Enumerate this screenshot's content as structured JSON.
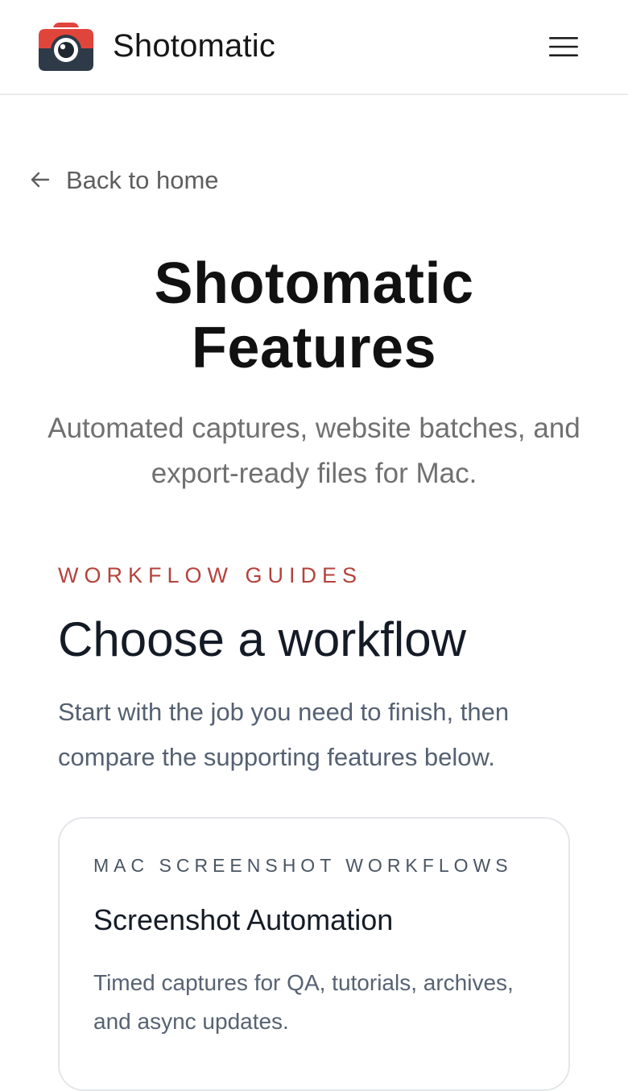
{
  "header": {
    "brand_name": "Shotomatic",
    "logo_icon": "camera-icon",
    "menu_icon": "hamburger-menu-icon"
  },
  "nav": {
    "back_label": "Back to home",
    "back_icon": "arrow-left-icon"
  },
  "hero": {
    "title_line1": "Shotomatic",
    "title_line2": "Features",
    "subtitle_line1": "Automated captures, website batches, and",
    "subtitle_line2": "export-ready files for Mac."
  },
  "workflows": {
    "eyebrow": "WORKFLOW GUIDES",
    "title": "Choose a workflow",
    "description_line1": "Start with the job you need to finish, then",
    "description_line2": "compare the supporting features below.",
    "cards": [
      {
        "eyebrow": "MAC SCREENSHOT WORKFLOWS",
        "title": "Screenshot Automation",
        "description_line1": "Timed captures for QA, tutorials, archives,",
        "description_line2": "and async updates."
      }
    ]
  },
  "colors": {
    "accent_red": "#b5423c",
    "logo_red": "#e0453c",
    "logo_dark": "#2e3a47",
    "heading": "#111111",
    "muted_text": "#707070",
    "border": "#e4e6ea"
  }
}
